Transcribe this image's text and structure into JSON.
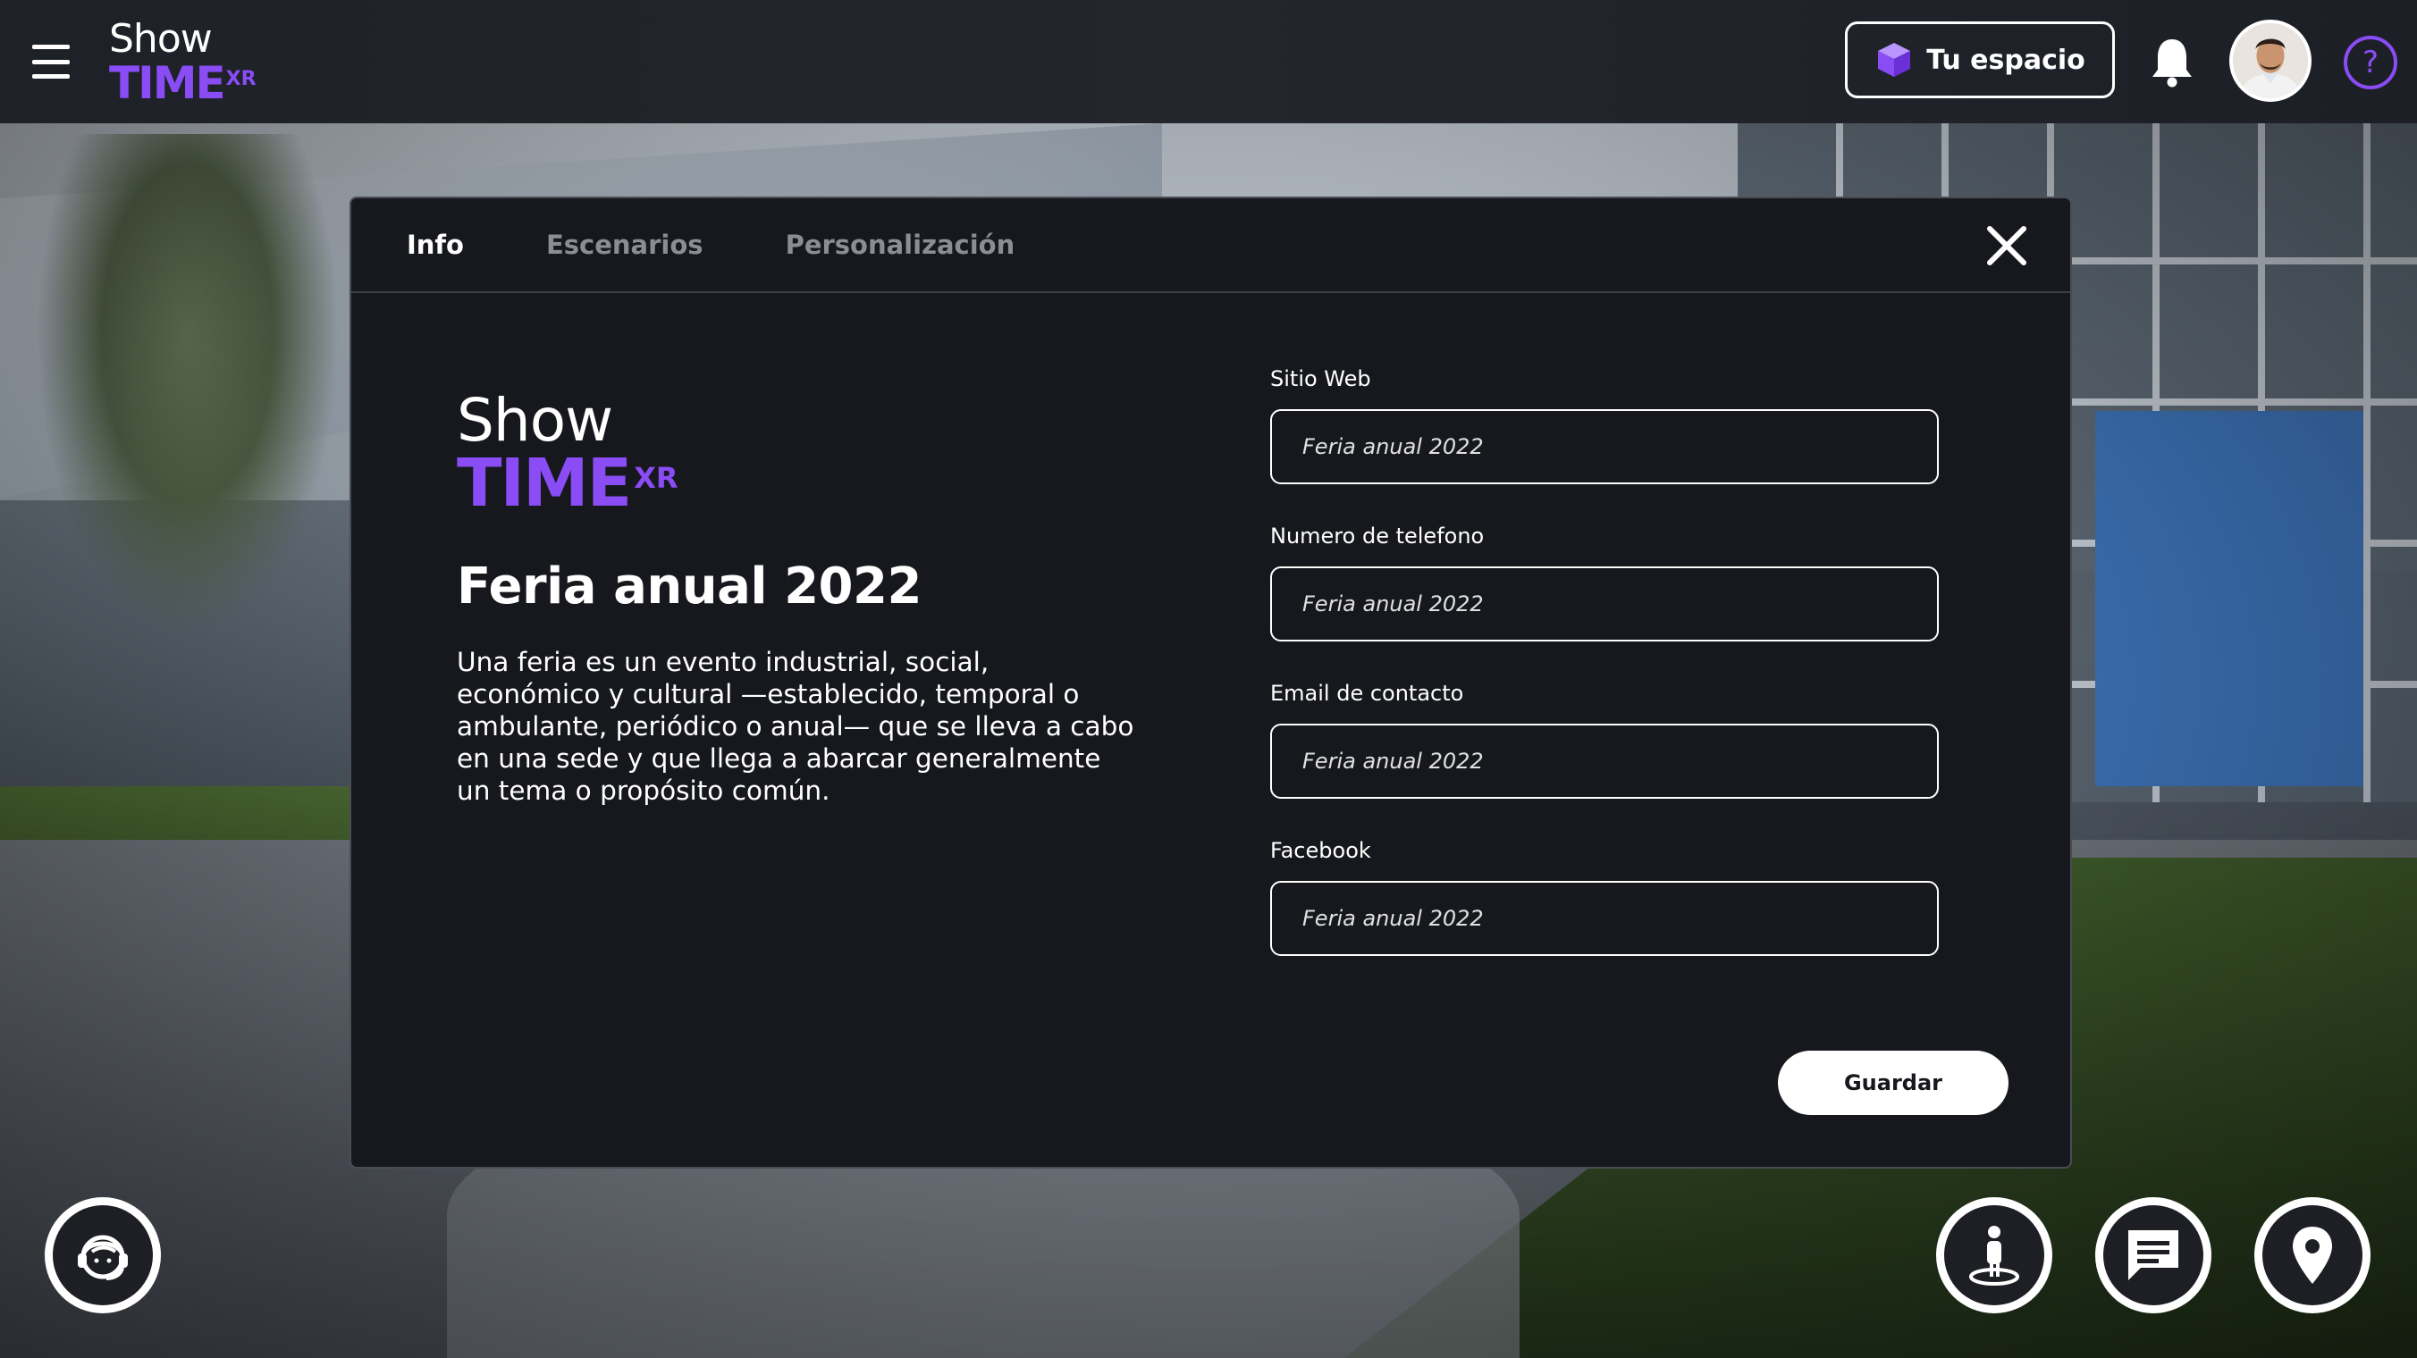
{
  "app": {
    "logo_show": "Show",
    "logo_time": "TIME",
    "logo_xr": "XR"
  },
  "topbar": {
    "space_button_label": "Tu espacio",
    "help_label": "?"
  },
  "modal": {
    "tabs": [
      {
        "label": "Info",
        "active": true
      },
      {
        "label": "Escenarios",
        "active": false
      },
      {
        "label": "Personalización",
        "active": false
      }
    ],
    "logo_show": "Show",
    "logo_time": "TIME",
    "logo_xr": "XR",
    "title": "Feria anual 2022",
    "description": "Una feria es un evento industrial, social, económico y cultural —establecido, temporal o ambulante, periódico o anual— que se lleva a cabo en una sede y que llega a abarcar generalmente un tema o propósito común.",
    "fields": [
      {
        "label": "Sitio Web",
        "placeholder": "Feria anual 2022"
      },
      {
        "label": "Numero de telefono",
        "placeholder": "Feria anual 2022"
      },
      {
        "label": "Email de contacto",
        "placeholder": "Feria anual 2022"
      },
      {
        "label": "Facebook",
        "placeholder": "Feria anual 2022"
      }
    ],
    "save_label": "Guardar"
  },
  "colors": {
    "accent": "#8a4cf5",
    "modal_bg": "#16181d",
    "topbar_bg": "#23262d"
  },
  "icons": {
    "menu": "hamburger-icon",
    "space": "cube-icon",
    "notifications": "bell-icon",
    "help": "question-icon",
    "close": "close-icon",
    "support": "support-agent-icon",
    "avatar": "person-standing-icon",
    "chat": "chat-icon",
    "map": "location-pin-icon"
  }
}
